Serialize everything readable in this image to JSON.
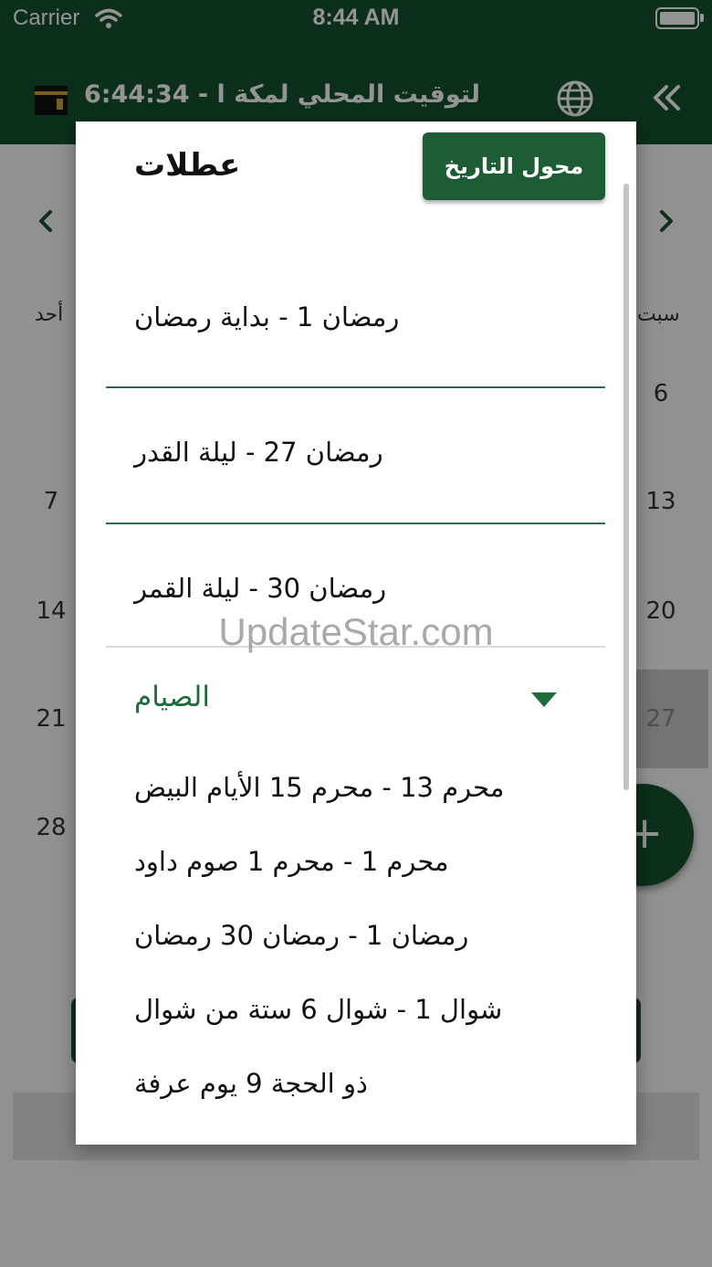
{
  "status_bar": {
    "carrier": "Carrier",
    "time": "8:44 AM"
  },
  "header": {
    "title": "لتوقيت المحلي لمكة ا - 6:44:34 PM"
  },
  "calendar": {
    "weekdays": {
      "sunday": "أحد",
      "saturday": "سبت"
    },
    "left_column_days": [
      "7",
      "14",
      "21",
      "28"
    ],
    "right_column_days": [
      "6",
      "13",
      "20",
      "27"
    ],
    "fab_label": "+"
  },
  "dialog": {
    "title": "عطلات",
    "convert_button": "محول التاريخ",
    "holidays": [
      "رمضان 1 - بداية رمضان",
      "رمضان 27 - ليلة القدر",
      "رمضان 30 - ليلة القمر"
    ],
    "fasting_section": {
      "title": "الصيام",
      "items": [
        "محرم 13 - محرم 15 الأيام البيض",
        "محرم 1 - محرم 1 صوم داود",
        "رمضان 1 - رمضان 30 رمضان",
        "شوال 1 - شوال 6 ستة من شوال",
        "ذو الحجة 9 يوم عرفة"
      ]
    }
  },
  "watermark": "UpdateStar.com",
  "colors": {
    "primary": "#16522f",
    "accent_text": "#1d6b3a",
    "divider": "#2f6b4a"
  }
}
